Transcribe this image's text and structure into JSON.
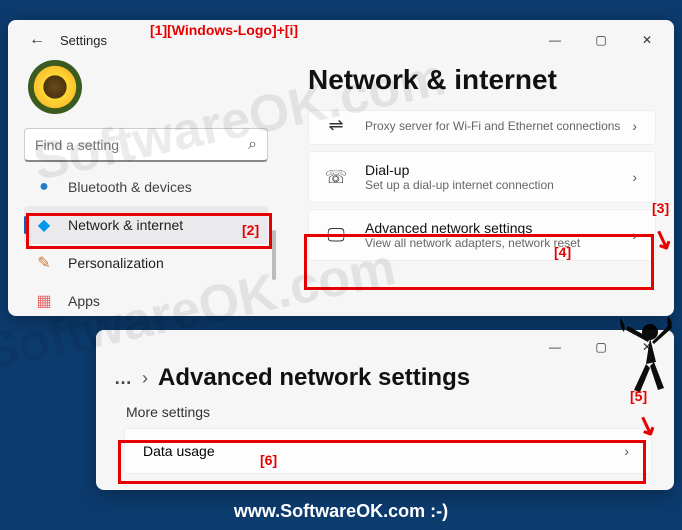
{
  "annotations": {
    "top": "[1][Windows-Logo]+[i]",
    "a2": "[2]",
    "a3": "[3]",
    "a4": "[4]",
    "a5": "[5]",
    "a6": "[6]"
  },
  "watermark": "SoftwareOK.com",
  "footer": "www.SoftwareOK.com :-)",
  "window1": {
    "title": "Settings",
    "search_placeholder": "Find a setting",
    "nav": {
      "bluetooth": "Bluetooth & devices",
      "network": "Network & internet",
      "personalization": "Personalization",
      "apps": "Apps"
    },
    "page_title": "Network & internet",
    "cards": {
      "proxy_sub": "Proxy server for Wi-Fi and Ethernet connections",
      "dialup_title": "Dial-up",
      "dialup_sub": "Set up a dial-up internet connection",
      "advanced_title": "Advanced network settings",
      "advanced_sub": "View all network adapters, network reset"
    }
  },
  "window2": {
    "breadcrumb_title": "Advanced network settings",
    "section": "More settings",
    "data_usage": "Data usage"
  }
}
